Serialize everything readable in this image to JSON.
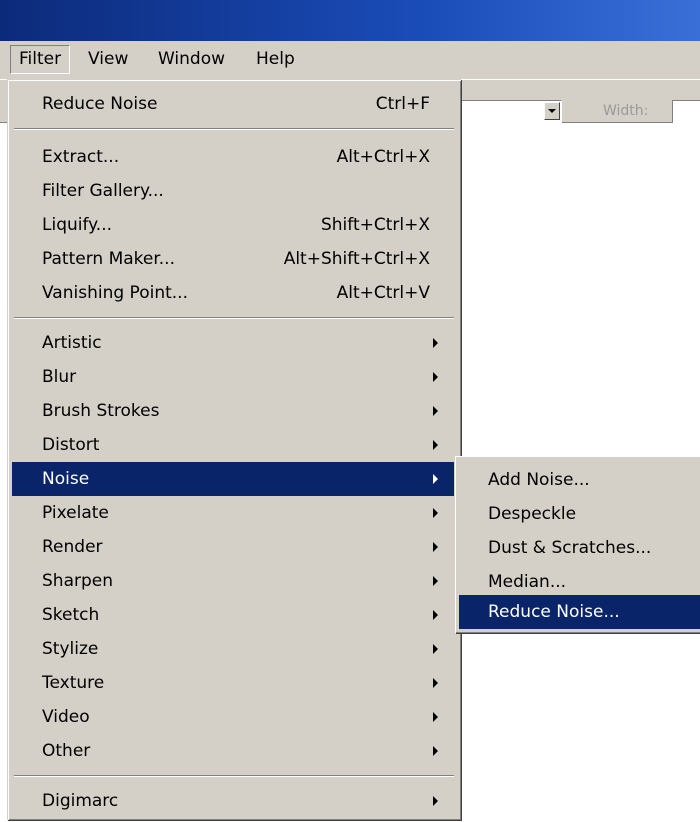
{
  "menubar": {
    "items": [
      {
        "label": "Filter",
        "open": true
      },
      {
        "label": "View"
      },
      {
        "label": "Window"
      },
      {
        "label": "Help"
      }
    ]
  },
  "options_bar": {
    "width_label": "Width:"
  },
  "filter_menu": {
    "last_filter": {
      "label": "Reduce Noise",
      "shortcut": "Ctrl+F"
    },
    "group_tools": [
      {
        "label": "Extract...",
        "shortcut": "Alt+Ctrl+X"
      },
      {
        "label": "Filter Gallery...",
        "shortcut": ""
      },
      {
        "label": "Liquify...",
        "shortcut": "Shift+Ctrl+X"
      },
      {
        "label": "Pattern Maker...",
        "shortcut": "Alt+Shift+Ctrl+X"
      },
      {
        "label": "Vanishing Point...",
        "shortcut": "Alt+Ctrl+V"
      }
    ],
    "group_filters": [
      {
        "label": "Artistic"
      },
      {
        "label": "Blur"
      },
      {
        "label": "Brush Strokes"
      },
      {
        "label": "Distort"
      },
      {
        "label": "Noise",
        "highlighted": true
      },
      {
        "label": "Pixelate"
      },
      {
        "label": "Render"
      },
      {
        "label": "Sharpen"
      },
      {
        "label": "Sketch"
      },
      {
        "label": "Stylize"
      },
      {
        "label": "Texture"
      },
      {
        "label": "Video"
      },
      {
        "label": "Other"
      }
    ],
    "group_plugins": [
      {
        "label": "Digimarc"
      }
    ]
  },
  "noise_submenu": {
    "items": [
      {
        "label": "Add Noise..."
      },
      {
        "label": "Despeckle"
      },
      {
        "label": "Dust & Scratches..."
      },
      {
        "label": "Median..."
      },
      {
        "label": "Reduce Noise...",
        "highlighted": true
      }
    ]
  },
  "colors": {
    "highlight": "#0a246a",
    "menu_background": "#d4d0c8",
    "titlebar": "#1a4cb8"
  }
}
